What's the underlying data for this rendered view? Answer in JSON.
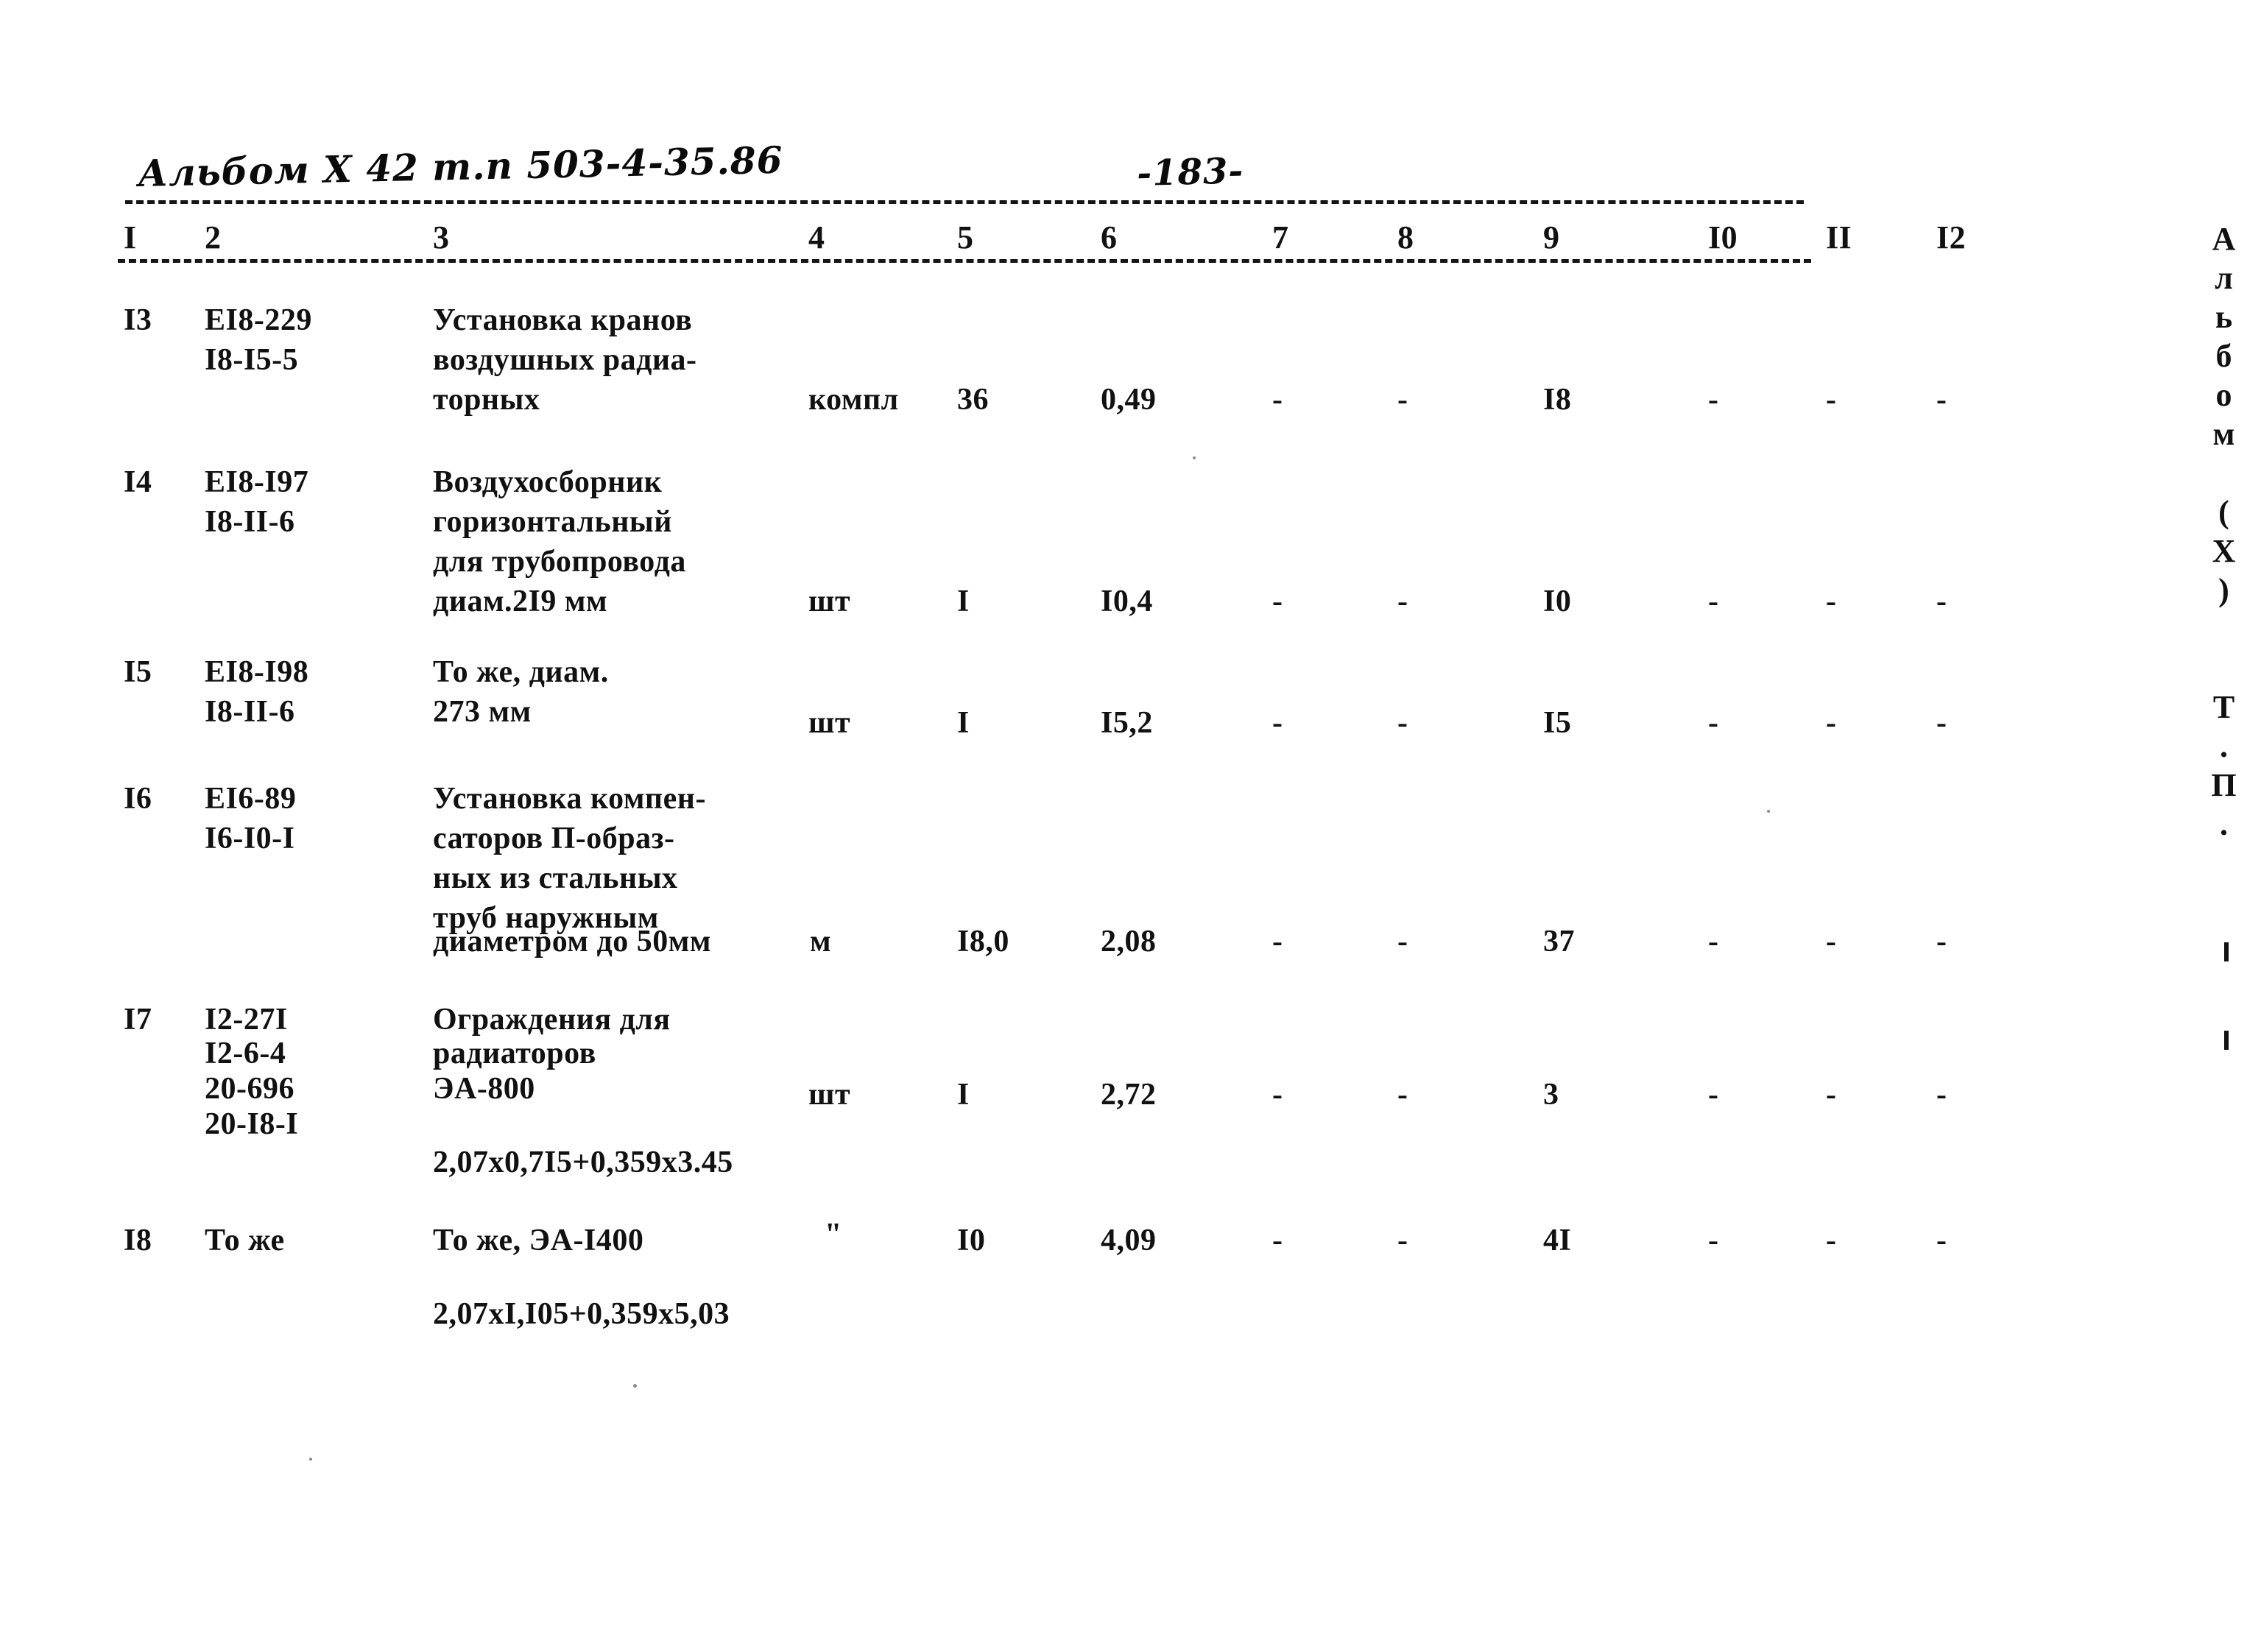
{
  "header": {
    "album_handwritten": "Альбом X 42 т.п 503-4-35.86",
    "page_number_handwritten": "-183-",
    "margin_vertical": "Альбом (Х)  Т.П."
  },
  "table": {
    "column_headers": [
      "I",
      "2",
      "3",
      "4",
      "5",
      "6",
      "7",
      "8",
      "9",
      "I0",
      "II",
      "I2"
    ],
    "rows": [
      {
        "no": "I3",
        "codes": [
          "EI8-229",
          "I8-I5-5"
        ],
        "description": [
          "Установка кранов",
          "воздушных радиа-",
          "торных"
        ],
        "unit": "компл",
        "qty": "36",
        "col6": "0,49",
        "col7": "-",
        "col8": "-",
        "col9": "I8",
        "col10": "-",
        "col11": "-",
        "col12": "-"
      },
      {
        "no": "I4",
        "codes": [
          "EI8-I97",
          "I8-II-6"
        ],
        "description": [
          "Воздухосборник",
          "горизонтальный",
          "для трубопровода",
          "диам.2I9 мм"
        ],
        "unit": "шт",
        "qty": "I",
        "col6": "I0,4",
        "col7": "-",
        "col8": "-",
        "col9": "I0",
        "col10": "-",
        "col11": "-",
        "col12": "-"
      },
      {
        "no": "I5",
        "codes": [
          "EI8-I98",
          "I8-II-6"
        ],
        "description": [
          "То же, диам.",
          "273 мм"
        ],
        "unit": "шт",
        "qty": "I",
        "col6": "I5,2",
        "col7": "-",
        "col8": "-",
        "col9": "I5",
        "col10": "-",
        "col11": "-",
        "col12": "-"
      },
      {
        "no": "I6",
        "codes": [
          "EI6-89",
          "I6-I0-I"
        ],
        "description": [
          "Установка компен-",
          "саторов П-образ-",
          "ных из стальных",
          "труб наружным",
          "диаметром до 50мм"
        ],
        "unit": "м",
        "qty": "I8,0",
        "col6": "2,08",
        "col7": "-",
        "col8": "-",
        "col9": "37",
        "col10": "-",
        "col11": "-",
        "col12": "-"
      },
      {
        "no": "I7",
        "codes": [
          "I2-27I",
          "I2-6-4",
          "20-696",
          "20-I8-I"
        ],
        "description": [
          "Ограждения для",
          "радиаторов",
          "ЭА-800"
        ],
        "dimensions": "2,07x0,7I5+0,359x3.45",
        "unit": "шт",
        "qty": "I",
        "col6": "2,72",
        "col7": "-",
        "col8": "-",
        "col9": "3",
        "col10": "-",
        "col11": "-",
        "col12": "-"
      },
      {
        "no": "I8",
        "codes": [
          "То же"
        ],
        "description": [
          "То же, ЭА-I400"
        ],
        "dimensions": "2,07xI,I05+0,359x5,03",
        "unit": "\"",
        "qty": "I0",
        "col6": "4,09",
        "col7": "-",
        "col8": "-",
        "col9": "4I",
        "col10": "-",
        "col11": "-",
        "col12": "-"
      }
    ]
  }
}
